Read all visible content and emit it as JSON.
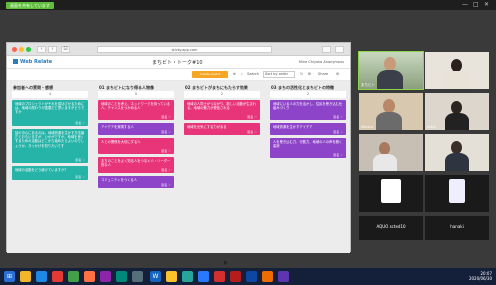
{
  "zoom": {
    "share_tag": "画面を共有しています",
    "controls": [
      "—",
      "□",
      "✕"
    ]
  },
  "browser": {
    "url": "sticky.app.com",
    "controls": [
      "‹",
      "›",
      "⊡"
    ]
  },
  "app": {
    "logo": "Web Relate",
    "board_title": "まちビト・トーク#10",
    "user": "Mine Chiyoko   Anonymous",
    "add_button": "Create post-it",
    "search_label": "Search",
    "sort_label": "Sort by order",
    "share_label": "Share"
  },
  "columns": [
    {
      "title": "参加者への質問・感想",
      "count": "4",
      "notes": [
        {
          "color": "teal",
          "text": "地域のプロジェクトがそれを成功させるためには、地域の関わりが重要だと思いますがどうですか",
          "meta": "匿名 ♡"
        },
        {
          "color": "teal",
          "text": "話の中心にあるのは、地域資源を生かす方法論だとおもいますが、いかがですか。地域を良くするための活動はどこから始めたらよいのでしょうか。きっかけを知りたいです",
          "meta": "匿名 ♡"
        },
        {
          "color": "teal",
          "text": "地域の活動をどう続けていますか？",
          "meta": "匿名 ♡"
        }
      ]
    },
    {
      "title": "01 まちビトになり得る人物像",
      "count": "5",
      "notes": [
        {
          "color": "pink",
          "text": "地域のことを考え、ネットワークを持っている人、チャンスをつかめる人",
          "meta": "匿名 ♡"
        },
        {
          "color": "purple",
          "text": "アイデアを実現する人",
          "meta": "匿名 ♡"
        },
        {
          "color": "pink",
          "text": "人との関係を大切にする人",
          "meta": "匿名 ♡"
        },
        {
          "color": "pink",
          "text": "まちのことをよく知る人をつなぐ人・リーダー的な人",
          "meta": "匿名 ♡"
        },
        {
          "color": "purple",
          "text": "コミュニティをつくる人",
          "meta": "匿名 ♡"
        }
      ]
    },
    {
      "title": "02 まちビトがまちにもたらす効果",
      "count": "2",
      "notes": [
        {
          "color": "pink",
          "text": "地域の人同士がつながり、新しい活動が生まれる。地域の魅力が発信される",
          "meta": "匿名 ♡"
        },
        {
          "color": "pink",
          "text": "地域を元気にする力がある",
          "meta": "匿名 ♡"
        }
      ]
    },
    {
      "title": "03 まちの活性化とまちビトの特徴",
      "count": "2",
      "notes": [
        {
          "color": "purple",
          "text": "地域にいる人の力を活かし、住民を巻き込む仕組みづくり",
          "meta": "匿名 ♡"
        },
        {
          "color": "purple",
          "text": "地域資源を生かすアイデア",
          "meta": "匿名 ♡"
        },
        {
          "color": "purple",
          "text": "人を巻き込む力、行動力、地域の人の声を聞く姿勢",
          "meta": "匿名 ♡"
        }
      ]
    }
  ],
  "participants": [
    {
      "name": "まちビト",
      "label_big": ""
    },
    {
      "name": "",
      "label_big": ""
    },
    {
      "name": "Minoru",
      "label_big": ""
    },
    {
      "name": "mika",
      "label_big": ""
    },
    {
      "name": "",
      "label_big": ""
    },
    {
      "name": "",
      "label_big": ""
    },
    {
      "name": "",
      "label_big": ""
    },
    {
      "name": "",
      "label_big": ""
    },
    {
      "name": "",
      "label_big": "AQUO scted10"
    },
    {
      "name": "",
      "label_big": "hanaki"
    }
  ],
  "taskbar": {
    "time": "20:07",
    "date": "2020/06/30"
  }
}
